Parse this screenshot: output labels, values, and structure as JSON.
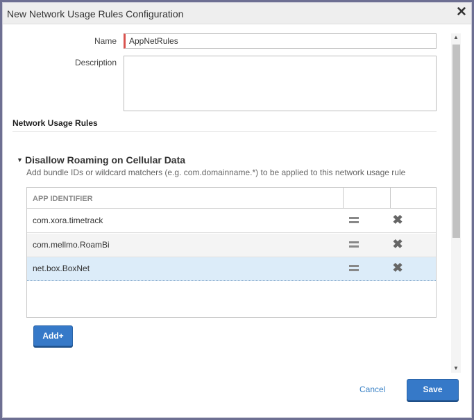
{
  "window": {
    "title": "New Network Usage Rules Configuration",
    "close_icon": "close-icon"
  },
  "form": {
    "name_label": "Name",
    "name_value": "AppNetRules",
    "description_label": "Description",
    "description_value": ""
  },
  "section": {
    "title": "Network Usage Rules"
  },
  "rule_group": {
    "title": "Disallow Roaming on Cellular Data",
    "description": "Add bundle IDs or wildcard matchers (e.g. com.domainname.*) to be applied to this network usage rule",
    "expanded": true
  },
  "table": {
    "column_header": "APP IDENTIFIER",
    "rows": [
      {
        "app_id": "com.xora.timetrack",
        "selected": false
      },
      {
        "app_id": "com.mellmo.RoamBi",
        "selected": false
      },
      {
        "app_id": "net.box.BoxNet",
        "selected": true
      }
    ],
    "icons": {
      "reorder": "drag-handle-icon",
      "remove": "delete-x-icon"
    }
  },
  "buttons": {
    "add": "Add+",
    "cancel": "Cancel",
    "save": "Save"
  },
  "colors": {
    "accent": "#3679c8",
    "required_marker": "#d9534f",
    "selected_row": "#dcecf9",
    "backdrop": "#6d6f92"
  }
}
